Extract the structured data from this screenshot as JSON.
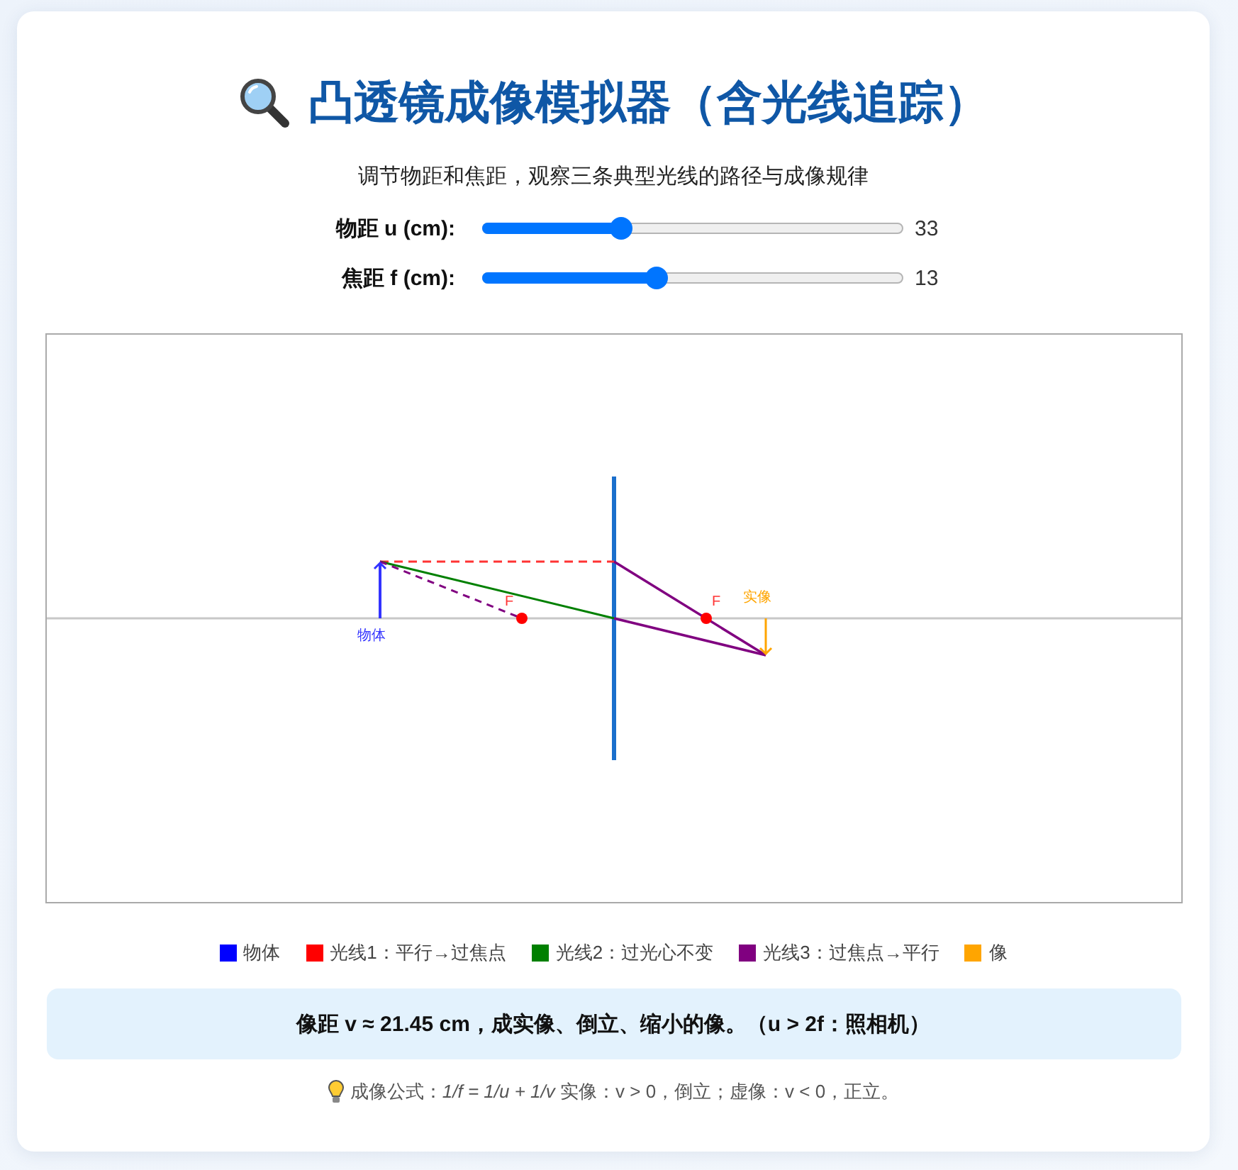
{
  "header": {
    "title": "凸透镜成像模拟器（含光线追踪）",
    "subtitle": "调节物距和焦距，观察三条典型光线的路径与成像规律"
  },
  "controls": [
    {
      "label": "物距 u (cm):",
      "value": "33",
      "level": 0.32
    },
    {
      "label": "焦距 f (cm):",
      "value": "13",
      "level": 0.41
    }
  ],
  "diagram": {
    "object_label": "物体",
    "focal_labels": [
      "F",
      "F"
    ],
    "image_label": "实像"
  },
  "legend": [
    {
      "label": "物体",
      "color": "#0000ff"
    },
    {
      "label": "光线1：平行→过焦点",
      "color": "#ff0000"
    },
    {
      "label": "光线2：过光心不变",
      "color": "#008000"
    },
    {
      "label": "光线3：过焦点→平行",
      "color": "#800080"
    },
    {
      "label": "像",
      "color": "#ffa500"
    }
  ],
  "result": "像距 v ≈ 21.45 cm，成实像、倒立、缩小的像。（u > 2f：照相机）",
  "formula": "成像公式：*1/f = 1/u + 1/v* 实像：v > 0，倒立；虚像：v < 0，正立。"
}
